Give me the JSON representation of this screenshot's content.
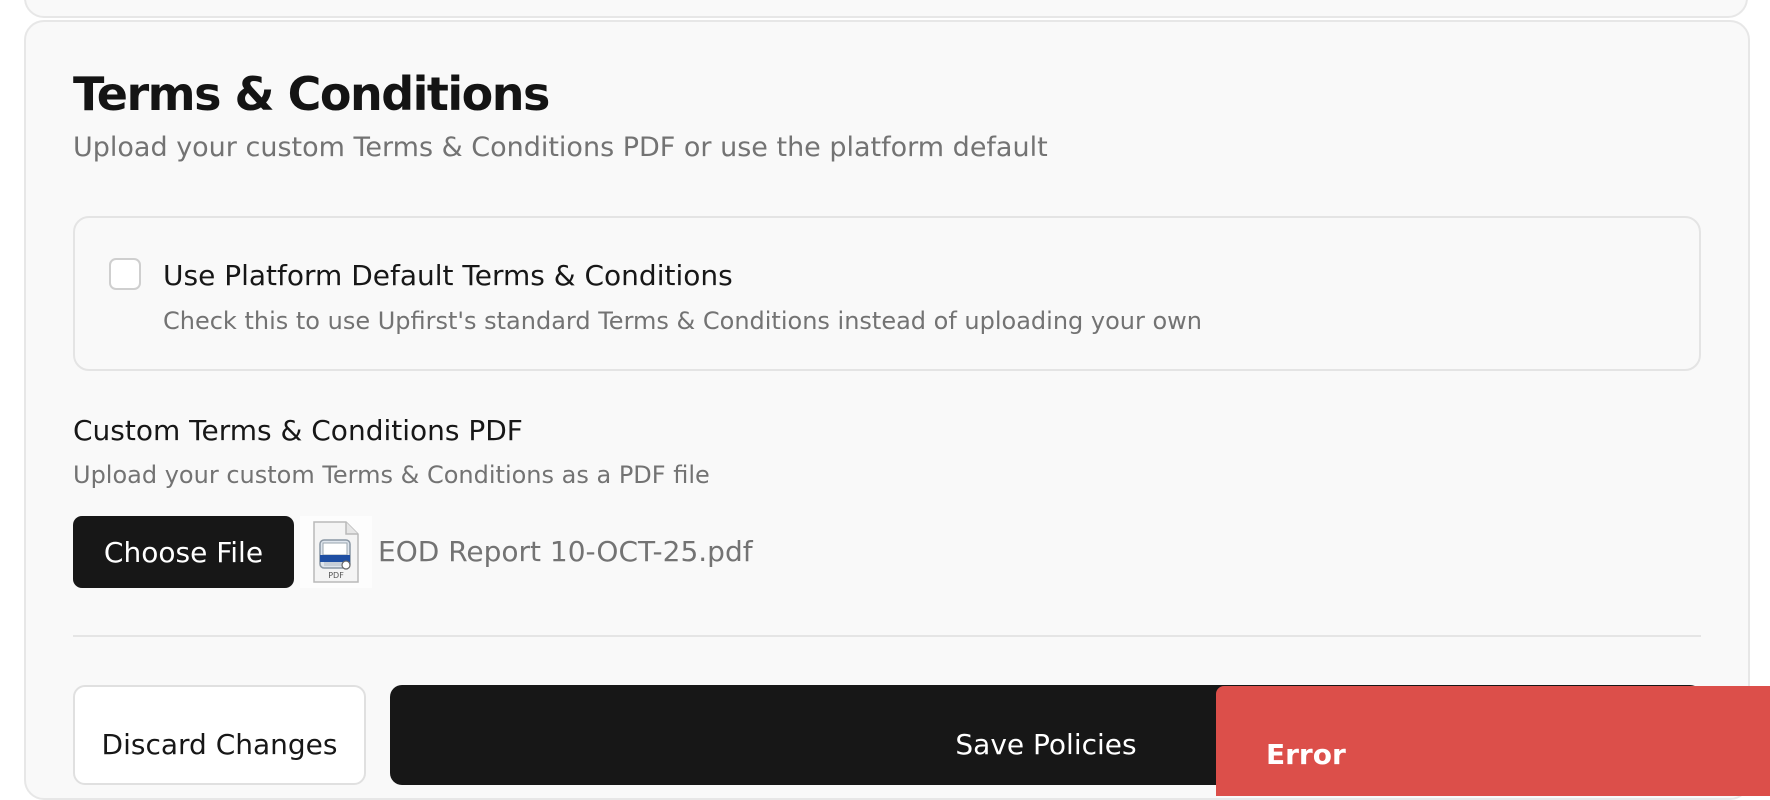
{
  "section": {
    "title": "Terms & Conditions",
    "subtitle": "Upload your custom Terms & Conditions PDF or use the platform default"
  },
  "default_option": {
    "checked": false,
    "label": "Use Platform Default Terms & Conditions",
    "description": "Check this to use Upfirst's standard Terms & Conditions instead of uploading your own"
  },
  "custom_pdf": {
    "label": "Custom Terms & Conditions PDF",
    "help": "Upload your custom Terms & Conditions as a PDF file",
    "choose_button": "Choose File",
    "file_name": "EOD Report 10-OCT-25.pdf",
    "file_icon": "pdf-file-icon",
    "file_icon_text": "PDF"
  },
  "actions": {
    "discard_label": "Discard Changes",
    "save_label": "Save Policies"
  },
  "toast": {
    "title": "Error",
    "color": "#dc4f4a"
  },
  "colors": {
    "primary": "#171717",
    "muted_text": "#737373",
    "card_bg": "#f9f9f9",
    "border": "#e4e4e4",
    "error": "#dc4f4a"
  }
}
